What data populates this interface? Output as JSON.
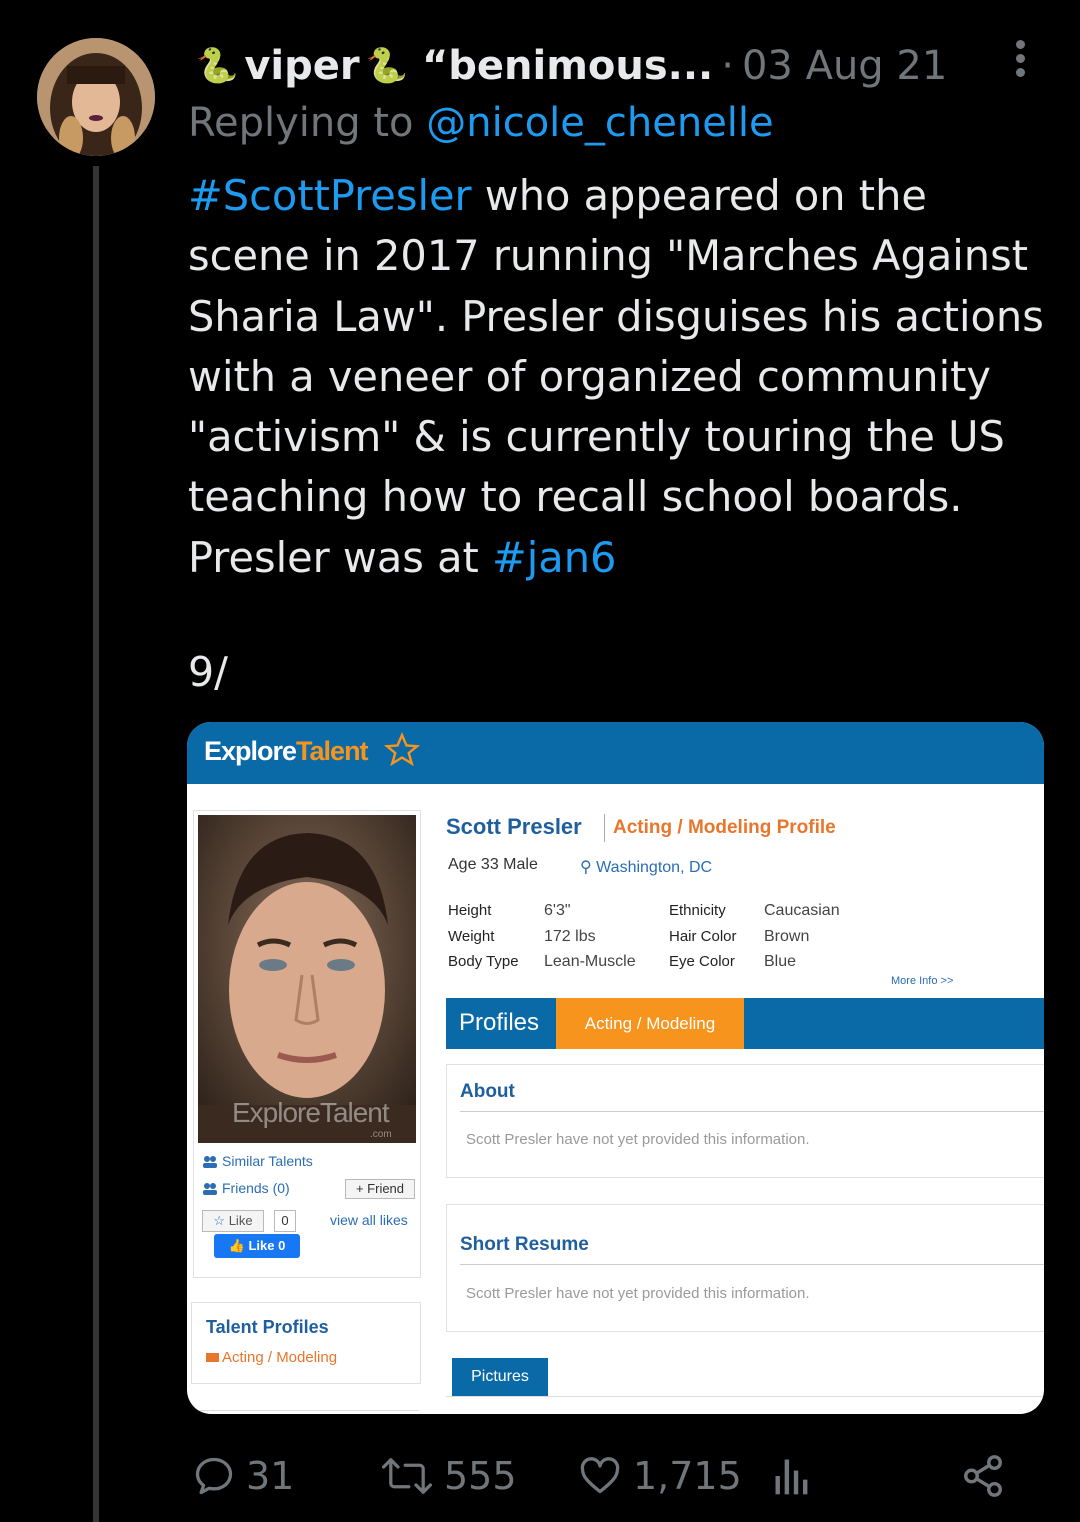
{
  "tweet": {
    "user_emoji": "🐍",
    "display_name": "viper",
    "handle_truncated": "“benimous...",
    "separator": "·",
    "date": "03 Aug 21",
    "replying_prefix": "Replying to ",
    "replying_to": "@nicole_chenelle",
    "hashtag1": "#ScottPresler",
    "body_main": " who appeared on the scene in 2017 running \"Marches Against Sharia Law\". Presler disguises his actions with a veneer of organized community \"activism\" & is currently touring the US teaching how to recall school boards. Presler was at ",
    "hashtag2": "#jan6",
    "count_label": "9/"
  },
  "card": {
    "logo_part1": "Explore",
    "logo_part2": "Talent",
    "watermark": "ExploreTalent",
    "watermark_sub": ".com",
    "sidebar": {
      "similar_talents": "Similar Talents",
      "friends": "Friends (0)",
      "add_friend": "+ Friend",
      "like": "Like",
      "like_count": "0",
      "view_all_likes": "view all likes",
      "fb_like": "Like 0"
    },
    "talent_profiles": {
      "title": "Talent Profiles",
      "item": "Acting / Modeling"
    },
    "profile": {
      "name": "Scott Presler",
      "type": "Acting / Modeling Profile",
      "age_sex": "Age 33 Male",
      "location": "Washington, DC",
      "stats": [
        {
          "label": "Height",
          "value": "6'3\""
        },
        {
          "label": "Weight",
          "value": "172 lbs"
        },
        {
          "label": "Body Type",
          "value": "Lean-Muscle"
        }
      ],
      "stats2": [
        {
          "label": "Ethnicity",
          "value": "Caucasian"
        },
        {
          "label": "Hair Color",
          "value": "Brown"
        },
        {
          "label": "Eye Color",
          "value": "Blue"
        }
      ],
      "more_info": "More Info >>"
    },
    "tabs": {
      "profiles": "Profiles",
      "acting": "Acting / Modeling"
    },
    "about": {
      "title": "About",
      "text": "Scott Presler have not yet provided this information."
    },
    "resume": {
      "title": "Short Resume",
      "text": "Scott Presler have not yet provided this information."
    },
    "pictures_tab": "Pictures"
  },
  "actions": {
    "replies": "31",
    "retweets": "555",
    "likes": "1,715"
  },
  "colors": {
    "link": "#1d9bf0",
    "explore_blue": "#0a6aa8",
    "explore_orange": "#f7941d"
  }
}
